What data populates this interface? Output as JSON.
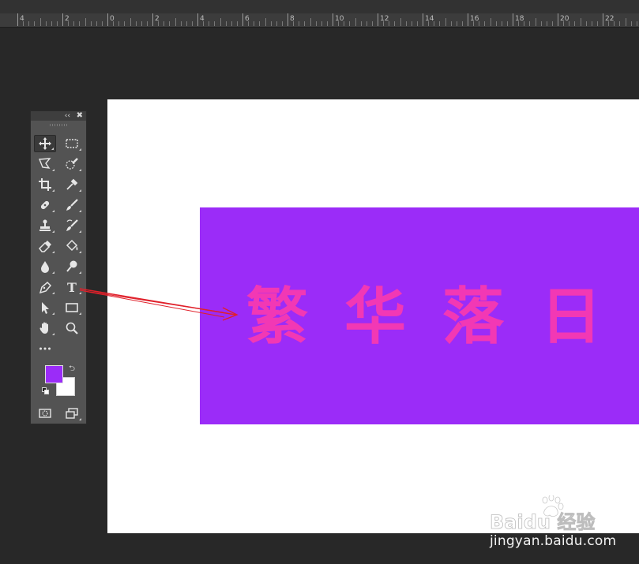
{
  "ruler": {
    "labels": [
      "4",
      "2",
      "0",
      "2",
      "4",
      "6",
      "8",
      "10",
      "12",
      "14",
      "16",
      "18",
      "20",
      "22"
    ]
  },
  "canvas": {
    "background": "#ffffff",
    "banner_color": "#9b2cf8",
    "text_color": "#f238b4",
    "chars": [
      "繁",
      "华",
      "落",
      "日"
    ]
  },
  "toolbar": {
    "collapse": "‹‹",
    "close": "✖",
    "tools": [
      {
        "name": "move-tool",
        "icon": "move-icon",
        "active": true
      },
      {
        "name": "rectangular-marquee-tool",
        "icon": "marquee-icon"
      },
      {
        "name": "polygonal-lasso-tool",
        "icon": "lasso-icon"
      },
      {
        "name": "quick-selection-tool",
        "icon": "quick-selection-icon"
      },
      {
        "name": "crop-tool",
        "icon": "crop-icon"
      },
      {
        "name": "eyedropper-tool",
        "icon": "eyedropper-icon"
      },
      {
        "name": "spot-healing-brush-tool",
        "icon": "bandage-icon"
      },
      {
        "name": "brush-tool",
        "icon": "brush-icon"
      },
      {
        "name": "clone-stamp-tool",
        "icon": "stamp-icon"
      },
      {
        "name": "history-brush-tool",
        "icon": "history-brush-icon"
      },
      {
        "name": "eraser-tool",
        "icon": "eraser-icon"
      },
      {
        "name": "paint-bucket-tool",
        "icon": "bucket-icon"
      },
      {
        "name": "blur-tool",
        "icon": "drop-icon"
      },
      {
        "name": "dodge-tool",
        "icon": "dodge-icon"
      },
      {
        "name": "pen-tool",
        "icon": "pen-icon"
      },
      {
        "name": "type-tool",
        "icon": "type-icon",
        "glyph": "T"
      },
      {
        "name": "path-selection-tool",
        "icon": "arrow-cursor-icon"
      },
      {
        "name": "rectangle-tool",
        "icon": "rectangle-icon"
      },
      {
        "name": "hand-tool",
        "icon": "hand-icon"
      },
      {
        "name": "zoom-tool",
        "icon": "zoom-icon"
      },
      {
        "name": "edit-toolbar",
        "icon": "more-icon"
      }
    ],
    "foreground_color": "#9b2cf8",
    "background_color": "#ffffff"
  },
  "watermark": {
    "logo_text": "Baidu 经验",
    "url": "jingyan.baidu.com"
  }
}
